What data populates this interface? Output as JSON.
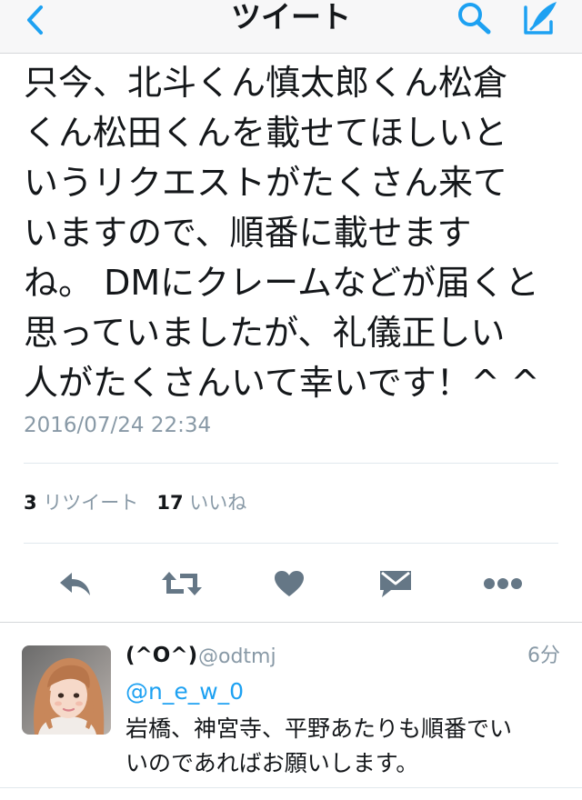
{
  "nav": {
    "title": "ツイート",
    "back_icon": "chevron-left-icon",
    "search_icon": "search-icon",
    "compose_icon": "compose-icon",
    "accent_color": "#1da1f2"
  },
  "tweet": {
    "lines": [
      "只今、北斗くん慎太郎くん松倉",
      "くん松田くんを載せてほしいと",
      "いうリクエストがたくさん来て",
      "いますので、順番に載せます",
      "ね。 DMにクレームなどが届くと",
      "思っていましたが、礼儀正しい",
      "人がたくさんいて幸いです！^ ^"
    ],
    "timestamp": "2016/07/24 22:34",
    "retweet_count": "3",
    "retweet_label": "リツイート",
    "like_count": "17",
    "like_label": "いいね"
  },
  "actions": [
    {
      "icon": "reply-icon"
    },
    {
      "icon": "retweet-icon"
    },
    {
      "icon": "heart-icon"
    },
    {
      "icon": "direct-message-icon"
    },
    {
      "icon": "more-icon"
    }
  ],
  "reply": {
    "display_name": "(^O^)",
    "handle": "@odtmj",
    "time": "6分",
    "mention": "@n_e_w_0",
    "lines": [
      "岩橋、神宮寺、平野あたりも順番でい",
      "いのであればお願いします。"
    ]
  }
}
